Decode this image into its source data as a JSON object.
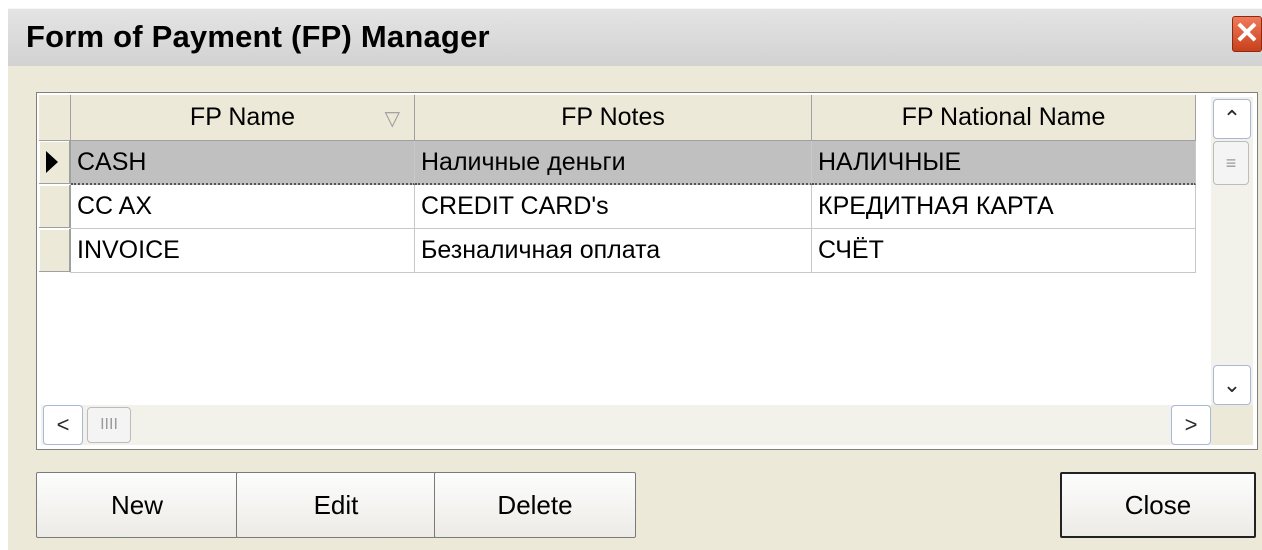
{
  "window": {
    "title": "Form of Payment (FP) Manager",
    "close_glyph": "✕"
  },
  "grid": {
    "columns": [
      {
        "label": "FP Name",
        "sort_icon": "▽"
      },
      {
        "label": "FP Notes"
      },
      {
        "label": "FP National Name"
      }
    ],
    "rows": [
      {
        "name": "CASH",
        "notes": "Наличные деньги",
        "national": "НАЛИЧНЫЕ",
        "selected": true
      },
      {
        "name": "CC AX",
        "notes": "CREDIT CARD's",
        "national": "КРЕДИТНАЯ КАРТА",
        "selected": false
      },
      {
        "name": "INVOICE",
        "notes": "Безналичная оплата",
        "national": "СЧЁТ",
        "selected": false
      }
    ]
  },
  "scroll": {
    "up": "⌃",
    "down": "⌄",
    "left": "<",
    "right": ">",
    "thumb_v": "≡",
    "thumb_h": "IIII"
  },
  "buttons": {
    "new": "New",
    "edit": "Edit",
    "delete": "Delete",
    "close": "Close"
  }
}
